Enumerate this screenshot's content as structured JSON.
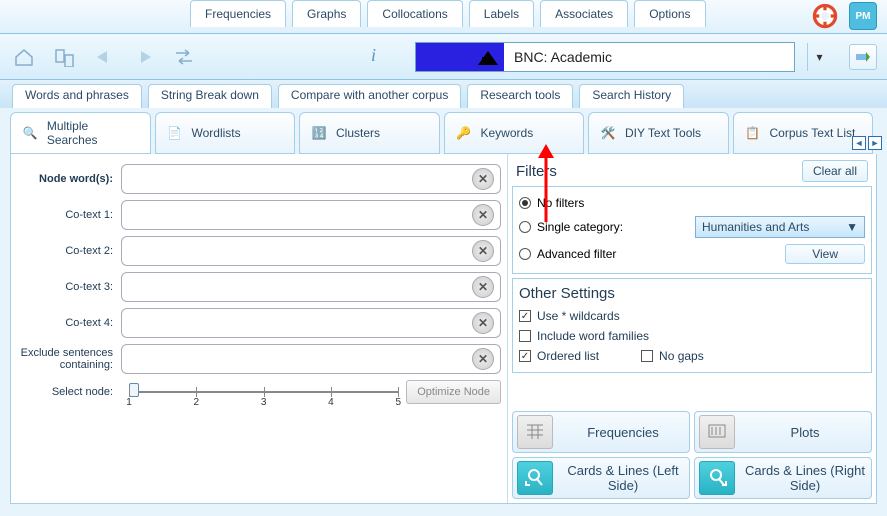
{
  "topTabs": {
    "frequencies": "Frequencies",
    "graphs": "Graphs",
    "collocations": "Collocations",
    "labels": "Labels",
    "associates": "Associates",
    "options": "Options"
  },
  "corpus": {
    "name": "BNC: Academic"
  },
  "secTabs": {
    "words": "Words and phrases",
    "string": "String Break down",
    "compare": "Compare with another corpus",
    "research": "Research tools",
    "history": "Search History"
  },
  "toolTabs": {
    "multiple": "Multiple Searches",
    "wordlists": "Wordlists",
    "clusters": "Clusters",
    "keywords": "Keywords",
    "diy": "DIY Text Tools",
    "corpusText": "Corpus Text List"
  },
  "fields": {
    "node": "Node word(s):",
    "c1": "Co-text 1:",
    "c2": "Co-text 2:",
    "c3": "Co-text 3:",
    "c4": "Co-text 4:",
    "exclude": "Exclude sentences containing:",
    "select": "Select node:"
  },
  "slider": {
    "t1": "1",
    "t2": "2",
    "t3": "3",
    "t4": "4",
    "t5": "5"
  },
  "optimize": "Optimize Node",
  "filters": {
    "title": "Filters",
    "clear": "Clear all",
    "none": "No filters",
    "single": "Single category:",
    "cat": "Humanities and Arts",
    "adv": "Advanced filter",
    "view": "View"
  },
  "other": {
    "title": "Other Settings",
    "wild": "Use * wildcards",
    "fam": "Include word families",
    "ord": "Ordered list",
    "gaps": "No gaps"
  },
  "actions": {
    "freq": "Frequencies",
    "plots": "Plots",
    "left": "Cards & Lines (Left Side)",
    "right": "Cards & Lines (Right Side)"
  }
}
